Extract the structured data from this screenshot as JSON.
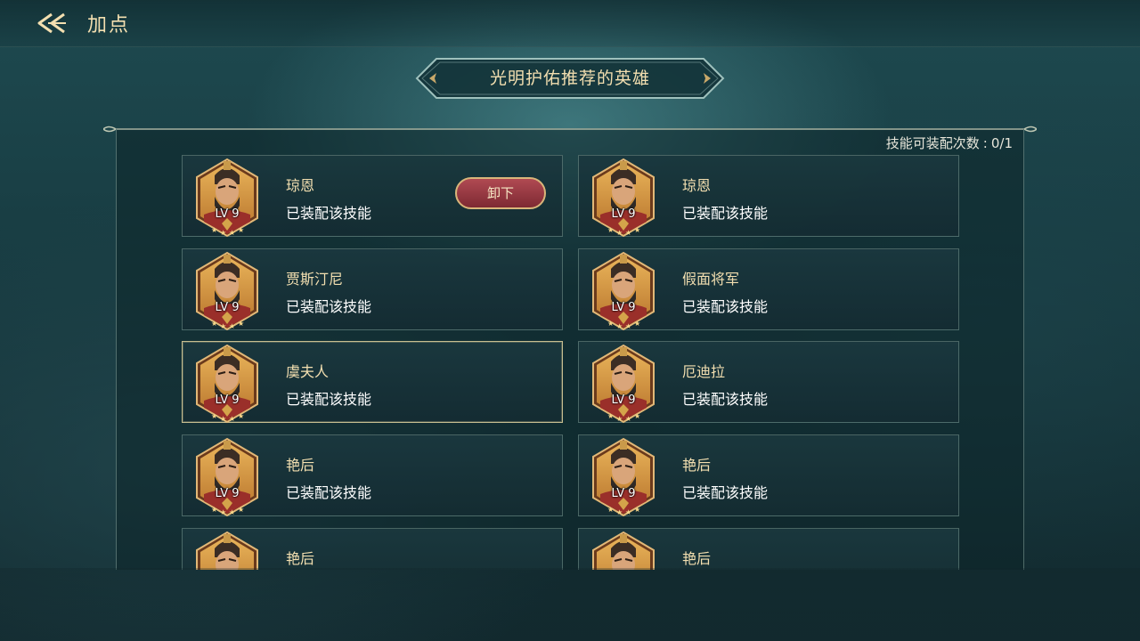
{
  "header": {
    "title": "加点",
    "back_icon": "double-chevron-left-icon"
  },
  "banner": {
    "title": "光明护佑推荐的英雄"
  },
  "quota": {
    "label": "技能可装配次数",
    "value": "0/1"
  },
  "colors": {
    "gold_text": "#f3dfb0",
    "button_red": "#9a3a43",
    "panel_border": "#a0beb4"
  },
  "cards": [
    {
      "name": "琼恩",
      "status": "已装配该技能",
      "level": "LV 9",
      "action": "卸下"
    },
    {
      "name": "琼恩",
      "status": "已装配该技能",
      "level": "LV 9"
    },
    {
      "name": "贾斯汀尼",
      "status": "已装配该技能",
      "level": "LV 9"
    },
    {
      "name": "假面将军",
      "status": "已装配该技能",
      "level": "LV 9"
    },
    {
      "name": "虞夫人",
      "status": "已装配该技能",
      "level": "LV 9"
    },
    {
      "name": "厄迪拉",
      "status": "已装配该技能",
      "level": "LV 9"
    },
    {
      "name": "艳后",
      "status": "已装配该技能",
      "level": "LV 9"
    },
    {
      "name": "艳后",
      "status": "已装配该技能",
      "level": "LV 9"
    },
    {
      "name": "艳后",
      "status": "",
      "level": ""
    },
    {
      "name": "艳后",
      "status": "",
      "level": ""
    }
  ]
}
